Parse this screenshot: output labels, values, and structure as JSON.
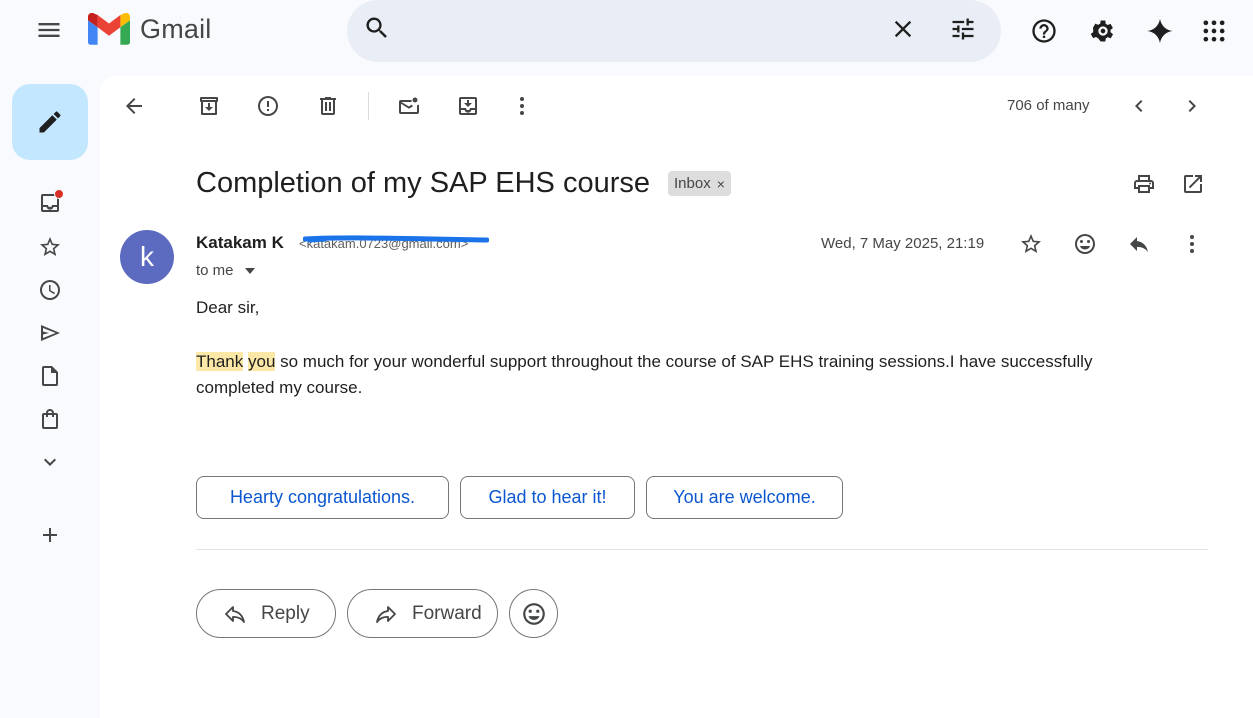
{
  "app": {
    "name": "Gmail"
  },
  "colors": {
    "accent": "#0b57d0",
    "compose": "#c2e7ff",
    "avatar": "#5c6bc0",
    "highlight": "#fce8a6",
    "badge_dot": "#d93025"
  },
  "header": {
    "search": {
      "value": "",
      "placeholder": ""
    },
    "icons": [
      "menu-icon",
      "search-icon",
      "close-icon",
      "tune-icon",
      "help-icon",
      "gear-icon",
      "sparkle-icon",
      "apps-grid-icon"
    ]
  },
  "rail": {
    "items": [
      "inbox-icon",
      "star-icon",
      "clock-icon",
      "send-icon",
      "file-icon",
      "clipboard-icon",
      "chevron-down-icon",
      "plus-icon"
    ],
    "inbox_has_unread": true
  },
  "toolbar": {
    "pager": "706 of many"
  },
  "message": {
    "subject": "Completion of my SAP EHS course",
    "label": "Inbox",
    "label_remove": "×",
    "sender": {
      "initial": "k",
      "name": "Katakam K",
      "email": "<katakam.0723@gmail.com>"
    },
    "recipient": "to me",
    "date": "Wed, 7 May 2025, 21:19",
    "greeting": "Dear sir,",
    "body": {
      "hl1": "Thank",
      "space": " ",
      "hl2": "you",
      "rest": " so much for your wonderful support throughout the course of SAP EHS training sessions.I have successfully completed my course."
    }
  },
  "smart_replies": [
    "Hearty congratulations.",
    "Glad to hear it!",
    "You are welcome."
  ],
  "actions": {
    "reply": "Reply",
    "forward": "Forward"
  }
}
